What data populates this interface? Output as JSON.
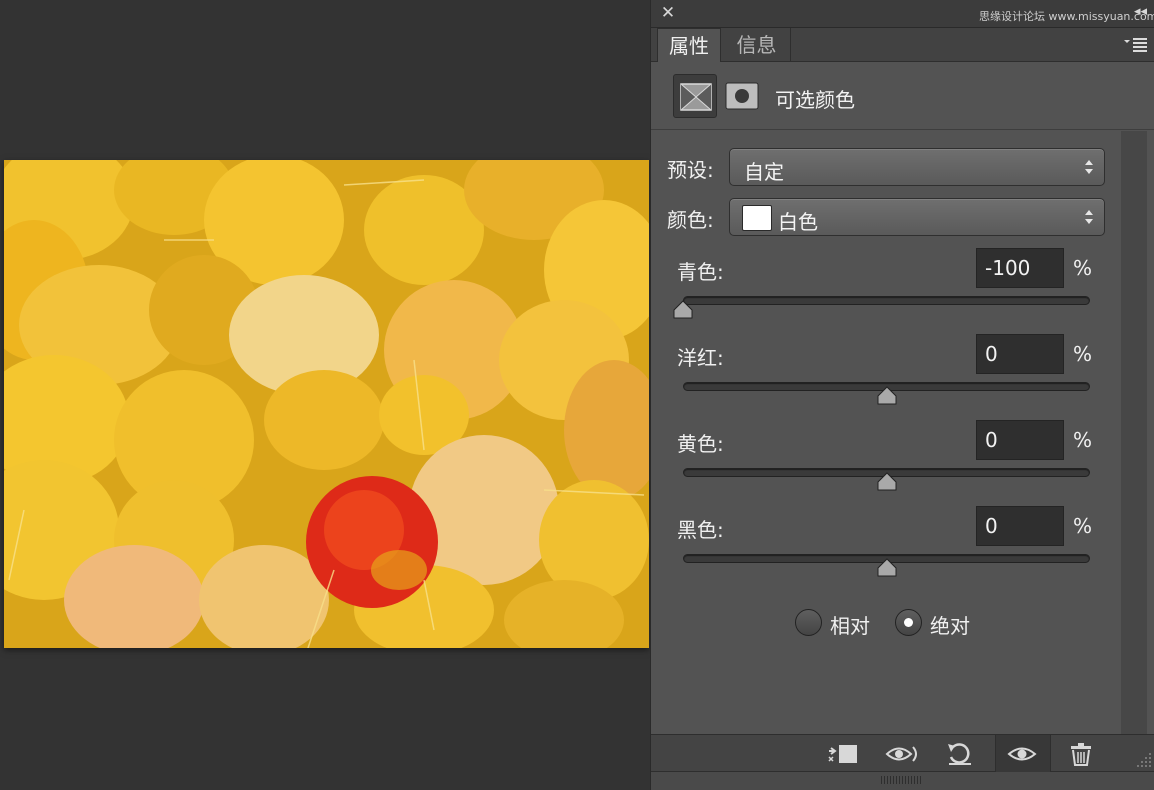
{
  "panel": {
    "watermark": "思缘设计论坛 www.missyuan.com",
    "tabs": {
      "properties": "属性",
      "info": "信息"
    },
    "adjustment_title": "可选颜色",
    "preset": {
      "label": "预设:",
      "value": "自定"
    },
    "colors": {
      "label": "颜色:",
      "value": "白色",
      "swatch_color": "#ffffff"
    },
    "sliders": [
      {
        "label": "青色:",
        "value": "-100",
        "unit": "%",
        "level": -100
      },
      {
        "label": "洋红:",
        "value": "0",
        "unit": "%",
        "level": 0
      },
      {
        "label": "黄色:",
        "value": "0",
        "unit": "%",
        "level": 0
      },
      {
        "label": "黑色:",
        "value": "0",
        "unit": "%",
        "level": 0
      }
    ],
    "method": {
      "relative": "相对",
      "absolute": "绝对",
      "selected": "absolute"
    },
    "bottom_icons": [
      "clip-to-layer-icon",
      "view-previous-state-icon",
      "reset-icon",
      "visibility-eye-icon",
      "trash-icon"
    ]
  },
  "image": {
    "subject": "yellow aspen leaves with one red leaf"
  }
}
